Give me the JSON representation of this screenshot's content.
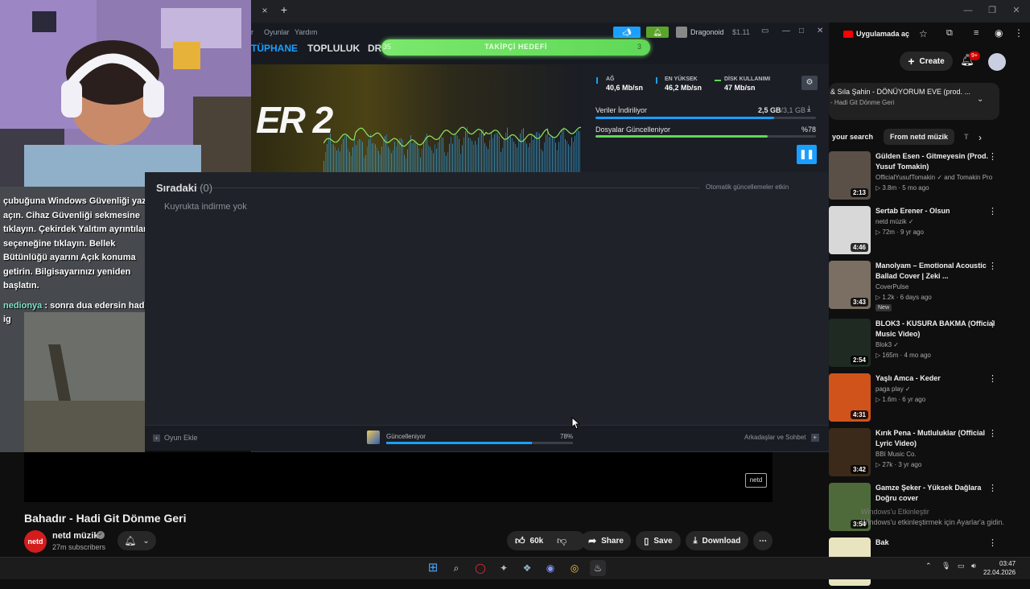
{
  "colors": {
    "steam_accent": "#1a9fff",
    "goal_green": "#6fe360",
    "yt_red": "#ff0000",
    "graph_green": "#8ee65c",
    "graph_blue": "#2a7fb8"
  },
  "browser": {
    "tab_close": "×",
    "new_tab": "+"
  },
  "steam": {
    "menu": [
      "r",
      "Oyunlar",
      "Yardım"
    ],
    "nav": {
      "library": "TÜPHANE",
      "community": "TOPLULUK",
      "dr": "DR"
    },
    "goal": {
      "label": "TAKİPÇİ HEDEFİ",
      "start": "35",
      "end": "3"
    },
    "user": "Dragonoid",
    "wallet": "$1.11",
    "stats": [
      {
        "label": "AĞ",
        "value": "40,6 Mb/sn"
      },
      {
        "label": "EN YÜKSEK",
        "value": "46,2 Mb/sn"
      },
      {
        "label": "DİSK KULLANIMI",
        "value": "47 Mb/sn"
      }
    ],
    "game_art_text": "ER 2",
    "downloading_label": "Veriler İndiriliyor",
    "downloaded": "2,5 GB",
    "download_total": "/3,1 GB",
    "download_progress": 0.81,
    "updating_label": "Dosyalar Güncelleniyor",
    "update_pct": "%78",
    "update_progress": 0.78,
    "queue_title": "Sıradaki",
    "queue_count": "(0)",
    "queue_empty": "Kuyrukta indirme yok",
    "auto_updates": "Otomatik güncellemeler etkin",
    "add_game": "Oyun Ekle",
    "bottom_status": "Güncelleniyor",
    "bottom_pct": "78%",
    "bottom_progress": 0.78,
    "friends_chat": "Arkadaşlar ve Sohbet"
  },
  "chat": {
    "msg1": "çubuğuna Windows Güvenliği yazıp açın. Cihaz Güvenliği sekmesine tıklayın. Çekirdek Yalıtım ayrıntıları seçeneğine tıklayın. Bellek Bütünlüğü ayarını Açık konuma getirin. Bilgisayarınızı yeniden başlatın.",
    "user": "nedionya",
    "msg2": ": sonra dua edersin hadi ig"
  },
  "youtube": {
    "open_app": "Uygulamada aç",
    "create": "Create",
    "notif_badge": "9+",
    "video_title": "Bahadır - Hadi Git Dönme Geri",
    "channel": "netd müzik",
    "channel_logo": "netd",
    "subscribers": "27m subscribers",
    "likes": "60k",
    "share": "Share",
    "save": "Save",
    "download": "Download",
    "now_playing": {
      "title": "& Sıla Şahin - DÖNÜYORUM EVE (prod. ...",
      "sub": "- Hadi Git Dönme Geri"
    },
    "chips": [
      "your search",
      "From netd müzik",
      "T"
    ],
    "recs": [
      {
        "title": "Gülden Esen - Gitmeyesin (Prod. Yusuf Tomakin)",
        "channel": "OfficialYusufTomakin ✓ and Tomakin Pro",
        "meta": "3.8m · 5 mo ago",
        "dur": "2:13",
        "color": "#5a5048"
      },
      {
        "title": "Sertab Erener - Olsun",
        "channel": "netd müzik ✓",
        "meta": "72m · 9 yr ago",
        "dur": "4:46",
        "color": "#d8d8d8"
      },
      {
        "title": "Manolyam – Emotional Acoustic Ballad Cover | Zeki ...",
        "channel": "CoverPulse",
        "meta": "1.2k · 6 days ago",
        "badge": "New",
        "dur": "3:43",
        "color": "#7a6f62"
      },
      {
        "title": "BLOK3 - KUSURA BAKMA (Official Music Video)",
        "channel": "Blok3 ✓",
        "meta": "165m · 4 mo ago",
        "dur": "2:54",
        "color": "#1e2a22"
      },
      {
        "title": "Yaşlı Amca - Keder",
        "channel": "paga play ✓",
        "meta": "1.6m · 6 yr ago",
        "dur": "4:31",
        "color": "#d0531c"
      },
      {
        "title": "Kırık Pena - Mutluluklar (Official Lyric Video)",
        "channel": "BBI Music Co.",
        "meta": "27k · 3 yr ago",
        "dur": "3:42",
        "color": "#3b2a1a"
      },
      {
        "title": "Gamze Şeker - Yüksek Dağlara Doğru cover",
        "channel": "",
        "meta": "",
        "dur": "3:54",
        "color": "#4f6a3a"
      },
      {
        "title": "Bak",
        "channel": "",
        "meta": "",
        "dur": "",
        "color": "#e8e4c0"
      }
    ]
  },
  "windows": {
    "watermark_line1": "Windows'u Etkinleştir",
    "watermark_line2": "Windows'u etkinleştirmek için Ayarlar'a gidin.",
    "time": "03:47",
    "date": "22.04.2026"
  }
}
